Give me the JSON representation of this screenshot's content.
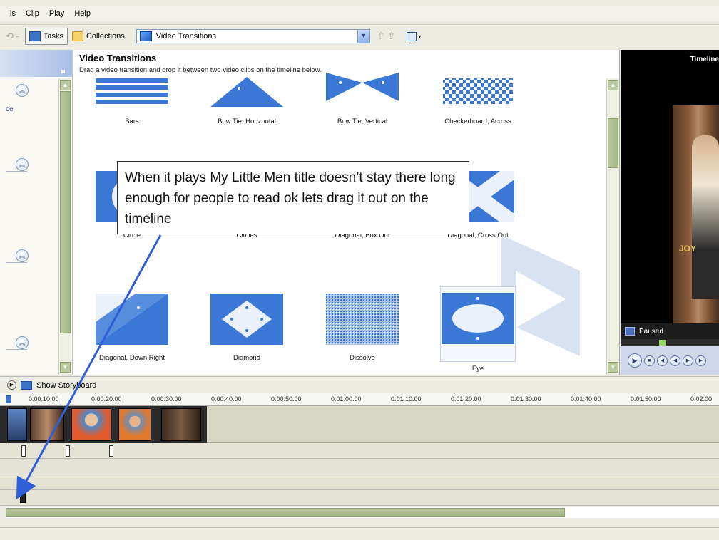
{
  "menu": {
    "items": [
      "ls",
      "Clip",
      "Play",
      "Help"
    ]
  },
  "toolbar": {
    "back_label": "⟲ -",
    "tasks_label": "Tasks",
    "collections_label": "Collections",
    "collection_value": "Video Transitions",
    "grayed_icons": "⇧ ⇪"
  },
  "taskpane": {
    "fragment": "ce"
  },
  "content": {
    "title": "Video Transitions",
    "description": "Drag a video transition and drop it between two video clips on the timeline below.",
    "items": [
      {
        "label": "Bars",
        "icon": "bars-icon"
      },
      {
        "label": "Bow Tie, Horizontal",
        "icon": "bow-tie-horizontal-icon"
      },
      {
        "label": "Bow Tie, Vertical",
        "icon": "bow-tie-vertical-icon"
      },
      {
        "label": "Checkerboard, Across",
        "icon": "checkerboard-icon"
      },
      {
        "label": "Circle",
        "icon": "circle-icon"
      },
      {
        "label": "Circles",
        "icon": "circles-icon"
      },
      {
        "label": "Diagonal, Box Out",
        "icon": "diagonal-box-out-icon"
      },
      {
        "label": "Diagonal, Cross Out",
        "icon": "diagonal-cross-out-icon"
      },
      {
        "label": "Diagonal, Down Right",
        "icon": "diagonal-down-right-icon"
      },
      {
        "label": "Diamond",
        "icon": "diamond-icon"
      },
      {
        "label": "Dissolve",
        "icon": "dissolve-icon"
      },
      {
        "label": "Eye",
        "icon": "eye-icon"
      }
    ]
  },
  "callout": {
    "text": "When it plays My Little Men title doesn’t stay there long enough for people to read ok lets drag it out on the timeline"
  },
  "monitor": {
    "title": "Timeline",
    "status": "Paused",
    "caption": "JOY"
  },
  "timeline": {
    "show_storyboard_label": "Show Storyboard",
    "ruler_ticks": [
      "0:00:10.00",
      "0:00:20.00",
      "0:00:30.00",
      "0:00:40.00",
      "0:00:50.00",
      "0:01:00.00",
      "0:01:10.00",
      "0:01:20.00",
      "0:01:30.00",
      "0:01:40.00",
      "0:01:50.00",
      "0:02:00"
    ]
  },
  "colors": {
    "accent": "#3b78d6",
    "arrow": "#2f5fd8",
    "scroll": "#a3b685"
  }
}
